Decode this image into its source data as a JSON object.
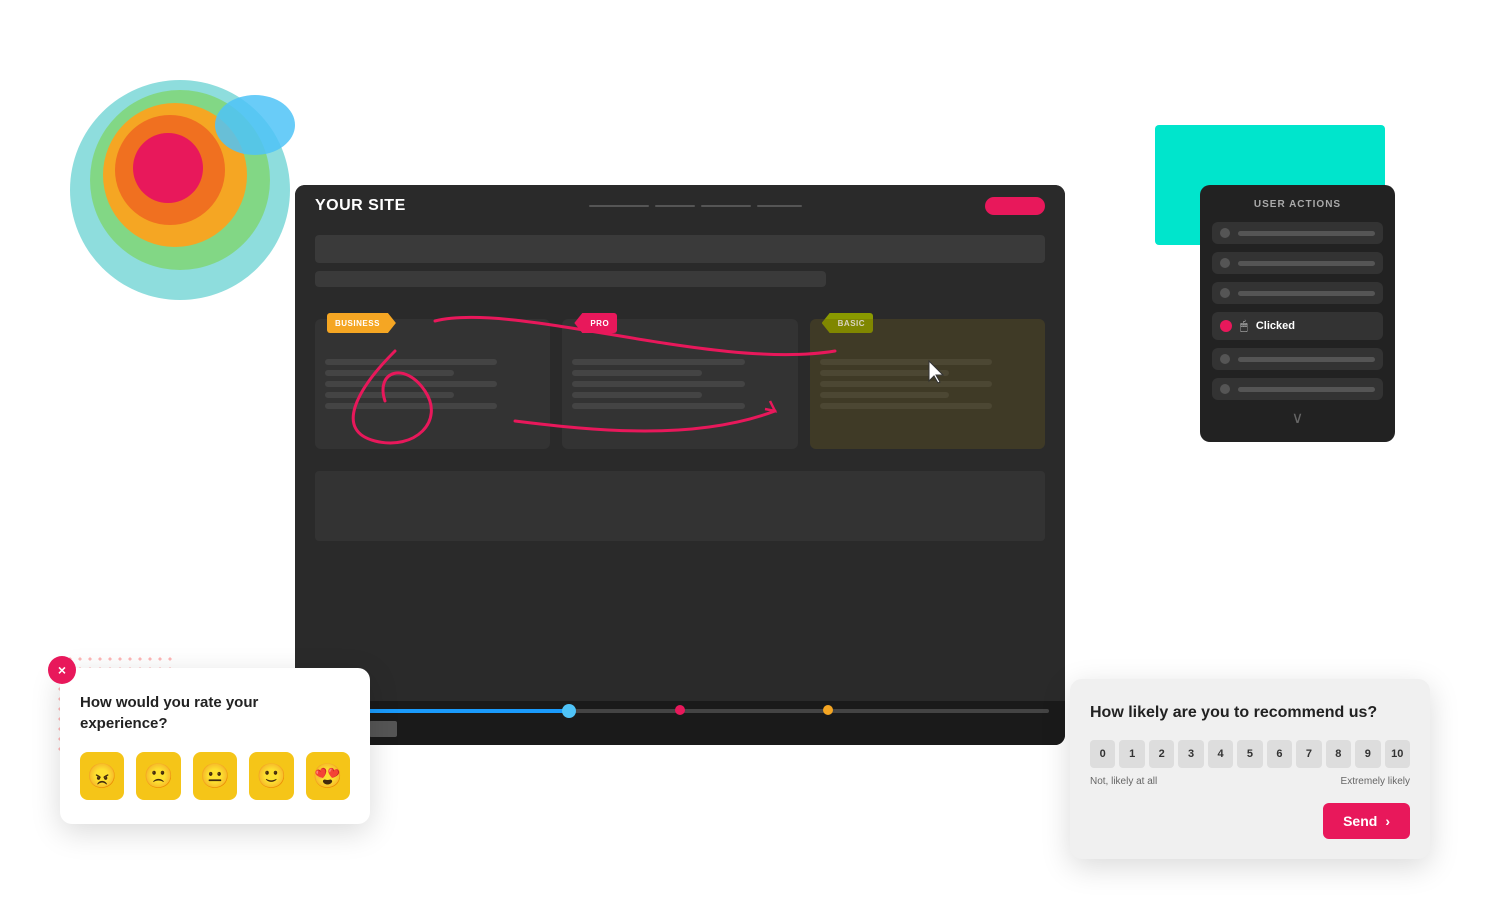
{
  "page": {
    "bg_teal": "teal rectangle decoration",
    "site": {
      "title": "YOUR SITE",
      "plan_business": "BUSINESS",
      "plan_pro": "PRO",
      "plan_basic": "BASIC"
    },
    "user_actions": {
      "title": "USER ACTIONS",
      "clicked_label": "Clicked",
      "chevron": "∨"
    },
    "survey": {
      "question": "How would you rate your experience?",
      "close_icon": "×",
      "emojis": [
        "😠",
        "🙁",
        "😐",
        "🙂",
        "😍"
      ]
    },
    "nps": {
      "question": "How likely are you to recommend us?",
      "numbers": [
        "0",
        "1",
        "2",
        "3",
        "4",
        "5",
        "6",
        "7",
        "8",
        "9",
        "10"
      ],
      "label_low": "Not, likely at all",
      "label_high": "Extremely likely",
      "send_label": "Send"
    }
  }
}
